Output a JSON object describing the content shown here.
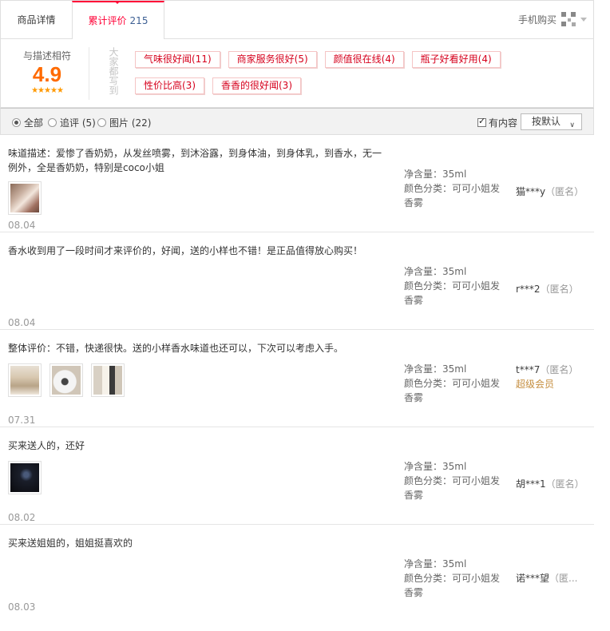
{
  "tabs": {
    "detail": "商品详情",
    "reviews": "累计评价",
    "review_count": "215",
    "mobile_buy": "手机购买"
  },
  "summary": {
    "score_label": "与描述相符",
    "score": "4.9",
    "stars": "★★★★★",
    "everyone_says": "大家都写到",
    "tags": [
      "气味很好闻(11)",
      "商家服务很好(5)",
      "颜值很在线(4)",
      "瓶子好看好用(4)",
      "性价比高(3)",
      "香香的很好闻(3)"
    ]
  },
  "filter": {
    "all": "全部",
    "followup": "追评 (5)",
    "pictures": "图片 (22)",
    "has_content": "有内容",
    "sort": "按默认"
  },
  "reviews": [
    {
      "text": "味道描述：爱惨了香奶奶，从发丝喷雾，到沐浴露，到身体油，到身体乳，到香水，无一例外，全是香奶奶，特别是coco小姐",
      "date": "08.04",
      "net": "净含量：35ml",
      "color": "颜色分类：可可小姐发香雾",
      "user": "猫***y",
      "anon": "（匿名）",
      "member": ""
    },
    {
      "text": "香水收到用了一段时间才来评价的，好闻，送的小样也不错！是正品值得放心购买！",
      "date": "08.04",
      "net": "净含量：35ml",
      "color": "颜色分类：可可小姐发香雾",
      "user": "r***2",
      "anon": "（匿名）",
      "member": ""
    },
    {
      "text": "整体评价：不错，快递很快。送的小样香水味道也还可以，下次可以考虑入手。",
      "date": "07.31",
      "net": "净含量：35ml",
      "color": "颜色分类：可可小姐发香雾",
      "user": "t***7",
      "anon": "（匿名）",
      "member": "超级会员"
    },
    {
      "text": "买来送人的，还好",
      "date": "08.02",
      "net": "净含量：35ml",
      "color": "颜色分类：可可小姐发香雾",
      "user": "胡***1",
      "anon": "（匿名）",
      "member": ""
    },
    {
      "text": "买来送姐姐的，姐姐挺喜欢的",
      "date": "08.03",
      "net": "净含量：35ml",
      "color": "颜色分类：可可小姐发香雾",
      "user": "诺***望",
      "anon": "（匿...",
      "member": ""
    }
  ],
  "colors": {
    "accent": "#ff0036",
    "score": "#ff6a00",
    "tag_text": "#d6001c",
    "member": "#c58e3f"
  }
}
